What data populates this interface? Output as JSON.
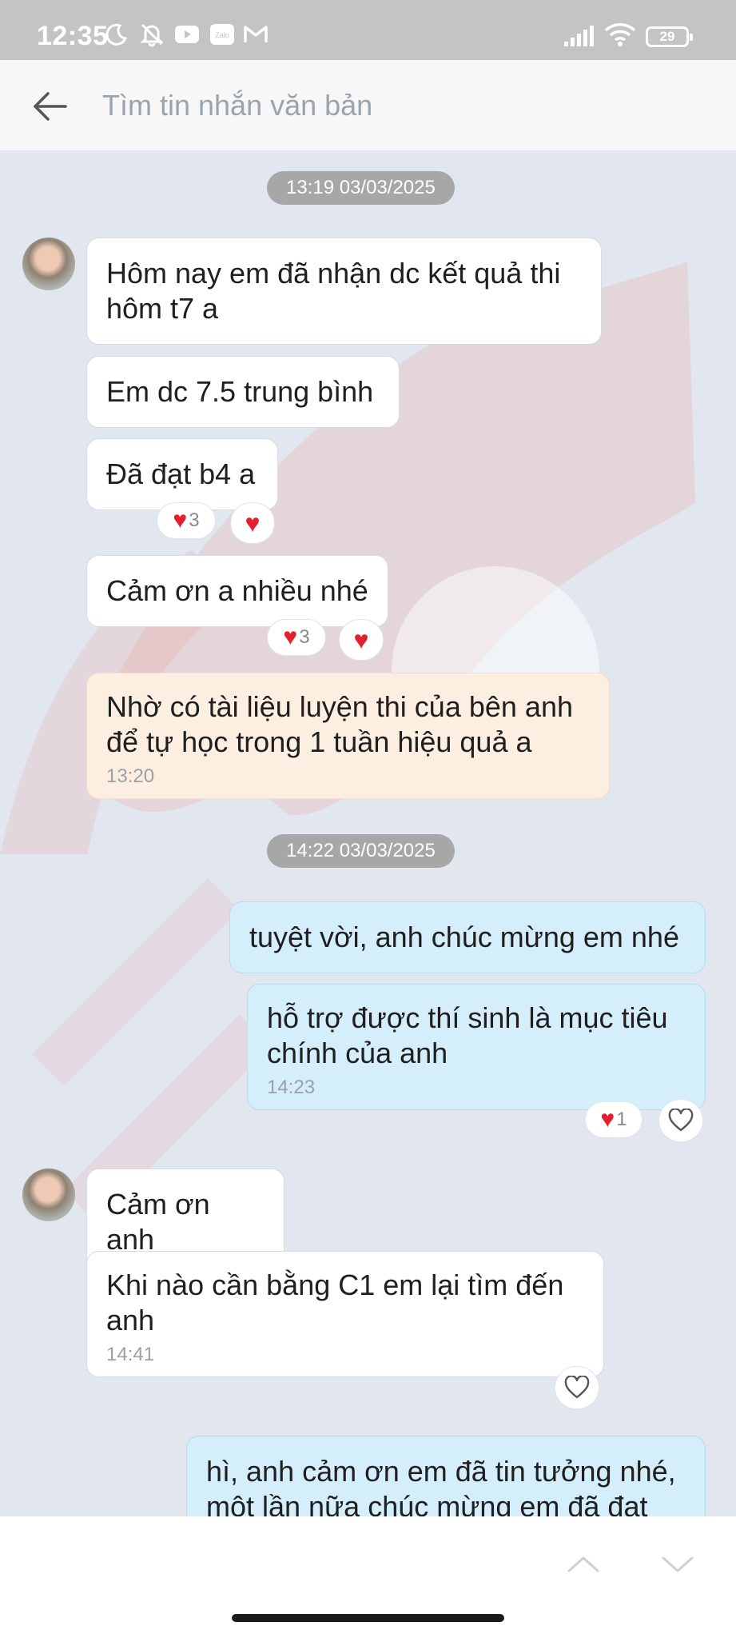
{
  "status_bar": {
    "time": "12:35",
    "left_icons": [
      "moon-icon",
      "bell-off-icon",
      "youtube-icon",
      "zalo-icon",
      "gmail-icon"
    ],
    "zalo_label": "Zalo",
    "battery": "29"
  },
  "search": {
    "placeholder": "Tìm tin nhắn văn bản"
  },
  "messages": {
    "date1": "13:19 03/03/2025",
    "m1": "Hôm nay em đã nhận dc kết quả thi hôm t7 a",
    "m2": "Em dc 7.5 trung bình",
    "m3": "Đã đạt b4 a",
    "m3_react_count": "3",
    "m4": "Cảm ơn a nhiều nhé",
    "m4_react_count": "3",
    "m5": "Nhờ có tài liệu luyện thi của bên anh để tự học trong 1 tuần hiệu quả a",
    "m5_time": "13:20",
    "date2": "14:22 03/03/2025",
    "m6": "tuyệt vời, anh chúc mừng em nhé",
    "m7": "hỗ trợ được thí sinh là mục tiêu chính của anh",
    "m7_time": "14:23",
    "m7_react_count": "1",
    "m8": "Cảm ơn anh",
    "m9": "Khi nào cần bằng C1 em lại tìm đến anh",
    "m9_time": "14:41",
    "m10": "hì, anh cảm ơn em đã tin tưởng nhé, một lần nữa chúc mừng em đã đạt"
  },
  "colors": {
    "status_bar": "#c4c4c4",
    "chat_bg": "#e1e6ef",
    "bubble_incoming": "#ffffff",
    "bubble_highlight": "#fdeee2",
    "bubble_outgoing": "#d4eefc",
    "date_pill": "#a7a7a7",
    "heart": "#e5202e"
  }
}
